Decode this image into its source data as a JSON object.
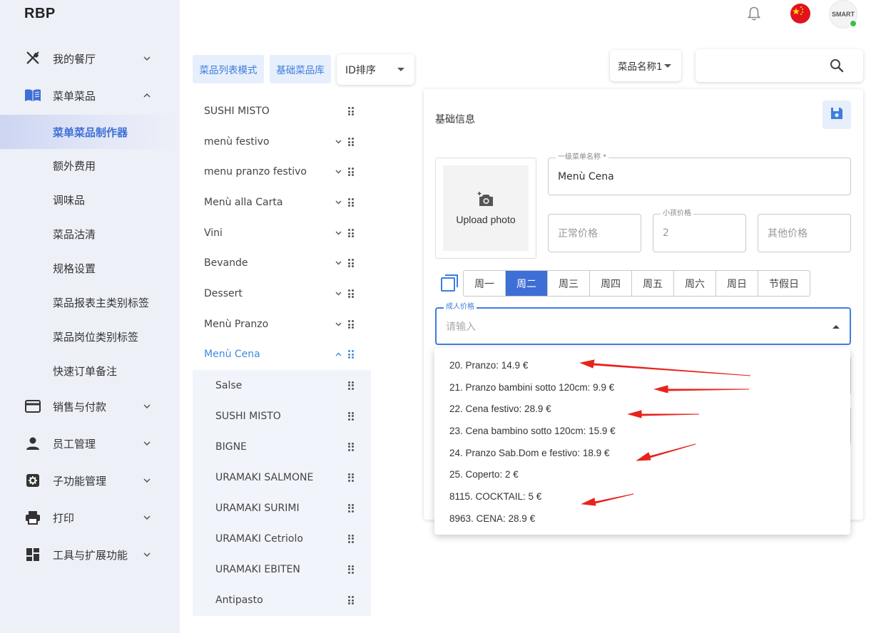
{
  "app": {
    "title": "RBP"
  },
  "sidebar": {
    "items": [
      {
        "label": "我的餐厅",
        "icon": "utensils-icon",
        "expanded": false
      },
      {
        "label": "菜单菜品",
        "icon": "menu-book-icon",
        "expanded": true,
        "children": [
          {
            "label": "菜单菜品制作器",
            "active": true
          },
          {
            "label": "额外费用"
          },
          {
            "label": "调味品"
          },
          {
            "label": "菜品沽清"
          },
          {
            "label": "规格设置"
          },
          {
            "label": "菜品报表主类别标签"
          },
          {
            "label": "菜品岗位类别标签"
          },
          {
            "label": "快速订单备注"
          }
        ]
      },
      {
        "label": "销售与付款",
        "icon": "credit-card-icon",
        "expanded": false
      },
      {
        "label": "员工管理",
        "icon": "person-icon",
        "expanded": false
      },
      {
        "label": "子功能管理",
        "icon": "gear-box-icon",
        "expanded": false
      },
      {
        "label": "打印",
        "icon": "printer-icon",
        "expanded": false
      },
      {
        "label": "工具与扩展功能",
        "icon": "dashboard-icon",
        "expanded": false
      }
    ]
  },
  "topbar": {
    "avatar_text": "SMART"
  },
  "toolbar": {
    "list_mode_label": "菜品列表模式",
    "base_library_label": "基础菜品库",
    "sort_value": "ID排序",
    "name_filter_value": "菜品名称1",
    "search_value": ""
  },
  "menu_list": {
    "items": [
      {
        "label": "SUSHI MISTO",
        "has_chevron": false
      },
      {
        "label": "menù festivo",
        "has_chevron": true
      },
      {
        "label": "menu pranzo festivo",
        "has_chevron": true
      },
      {
        "label": "Menù alla Carta",
        "has_chevron": true
      },
      {
        "label": "Vini",
        "has_chevron": true
      },
      {
        "label": "Bevande",
        "has_chevron": true
      },
      {
        "label": "Dessert",
        "has_chevron": true
      },
      {
        "label": "Menù Pranzo",
        "has_chevron": true
      },
      {
        "label": "Menù Cena",
        "has_chevron": true,
        "active": true,
        "expanded": true
      }
    ],
    "children": [
      {
        "label": "Salse"
      },
      {
        "label": "SUSHI MISTO"
      },
      {
        "label": "BIGNE"
      },
      {
        "label": "URAMAKI SALMONE"
      },
      {
        "label": "URAMAKI SURIMI"
      },
      {
        "label": "URAMAKI Cetriolo"
      },
      {
        "label": "URAMAKI EBITEN"
      },
      {
        "label": "Antipasto"
      }
    ]
  },
  "panel": {
    "title": "基础信息",
    "upload_label": "Upload photo",
    "menu_name": {
      "legend": "一级菜单名称 *",
      "value": "Menù Cena"
    },
    "regular_price": {
      "placeholder": "正常价格"
    },
    "child_price": {
      "legend": "小孩价格",
      "value": "2"
    },
    "other_price": {
      "placeholder": "其他价格"
    },
    "days": [
      "周一",
      "周二",
      "周三",
      "周四",
      "周五",
      "周六",
      "周日",
      "节假日"
    ],
    "active_day": "周二",
    "adult_price": {
      "legend": "成人价格",
      "placeholder": "请输入"
    }
  },
  "dropdown": {
    "options": [
      "20. Pranzo: 14.9 €",
      "21. Pranzo bambini sotto 120cm: 9.9 €",
      "22. Cena festivo: 28.9 €",
      "23. Cena bambino sotto 120cm: 15.9 €",
      "24. Pranzo Sab.Dom e festivo: 18.9 €",
      "25. Coperto: 2 €",
      "8115. COCKTAIL: 5 €",
      "8963. CENA: 28.9 €"
    ]
  },
  "colors": {
    "accent": "#3d6fd6",
    "link": "#3d8be0",
    "annotation_arrow": "#e8231c",
    "flag": "#e1141e"
  }
}
